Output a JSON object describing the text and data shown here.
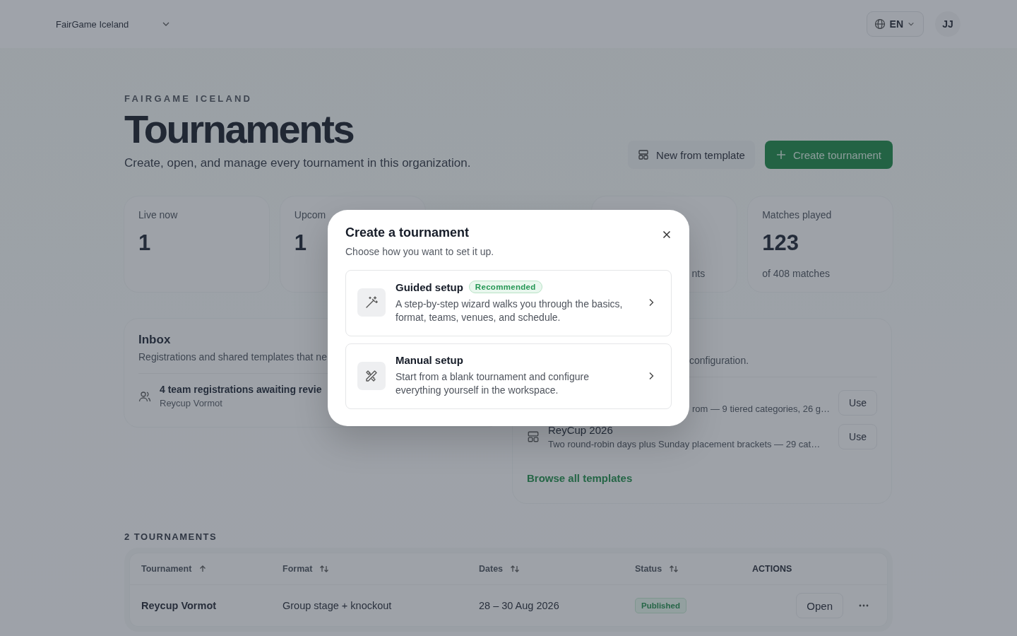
{
  "header": {
    "org": "FairGame Iceland",
    "language": "EN",
    "avatar": "JJ"
  },
  "page": {
    "eyebrow": "FAIRGAME ICELAND",
    "title": "Tournaments",
    "subtitle": "Create, open, and manage every tournament in this organization.",
    "actions": [
      {
        "label": "New from template",
        "kind": "secondary"
      },
      {
        "label": "Create tournament",
        "kind": "primary"
      }
    ]
  },
  "stats": [
    {
      "label": "Live now",
      "value": "1"
    },
    {
      "label": "Upcom",
      "value": "1"
    },
    {
      "note": "nts"
    },
    {
      "label": "Matches played",
      "value": "123",
      "note": "of 408 matches"
    }
  ],
  "inbox": {
    "title": "Inbox",
    "description": "Registrations and shared templates that ne",
    "items": [
      {
        "title": "4 team registrations awaiting revie",
        "subtitle": "Reycup Vormot"
      }
    ]
  },
  "templates": {
    "description": "configuration.",
    "items": [
      {
        "description": "rom — 9 tiered categories, 26 g…",
        "action": "Use"
      },
      {
        "name": "ReyCup 2026",
        "description": "Two round-robin days plus Sunday placement brackets — 29 cat…",
        "action": "Use"
      }
    ],
    "link": "Browse all templates"
  },
  "table": {
    "heading": "2 TOURNAMENTS",
    "columns": [
      {
        "label": "Tournament",
        "sorted": true
      },
      {
        "label": "Format",
        "sorted": false
      },
      {
        "label": "Dates",
        "sorted": false
      },
      {
        "label": "Status",
        "sorted": false
      },
      {
        "label": "ACTIONS"
      }
    ],
    "rows": [
      {
        "name": "Reycup Vormot",
        "format": "Group stage + knockout",
        "dates": "28 – 30 Aug 2026",
        "status": "Published",
        "action": "Open"
      }
    ]
  },
  "modal": {
    "title": "Create a tournament",
    "subtitle": "Choose how you want to set it up.",
    "options": [
      {
        "kind": "guided",
        "title": "Guided setup",
        "badge": "Recommended",
        "description": "A step-by-step wizard walks you through the basics, format, teams, venues, and schedule."
      },
      {
        "kind": "manual",
        "title": "Manual setup",
        "description": "Start from a blank tournament and configure everything yourself in the workspace."
      }
    ]
  }
}
